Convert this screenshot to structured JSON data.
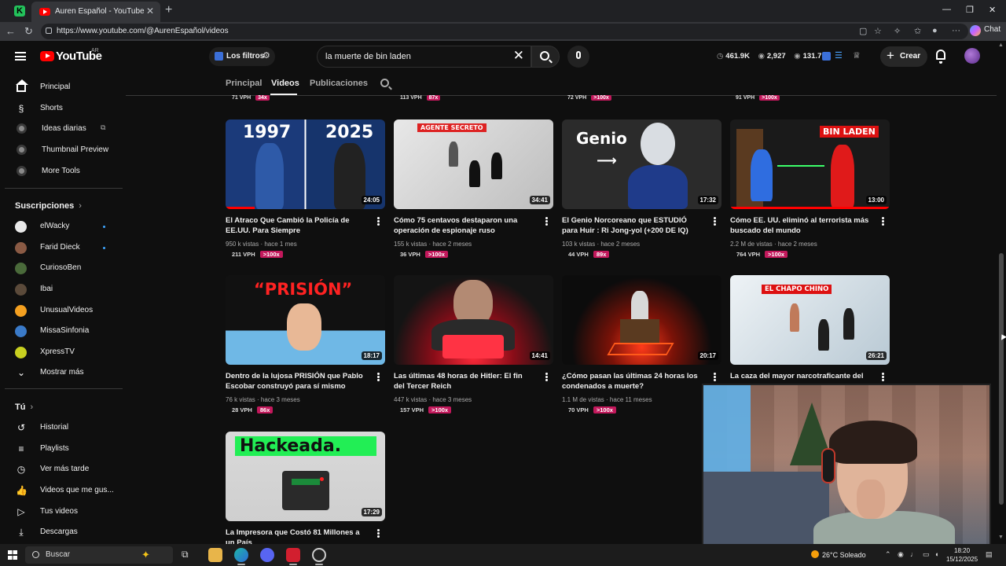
{
  "browser": {
    "tab_title": "Auren Español - YouTube",
    "url": "https://www.youtube.com/@AurenEspañol/videos",
    "chat_label": "Chat"
  },
  "header": {
    "logo": "YouTube",
    "country": "AR",
    "filters_label": "Los filtros",
    "search_value": "la muerte de bin laden",
    "stats": [
      "461.9K",
      "2,927",
      "131.7K"
    ],
    "create_label": "Crear"
  },
  "sidebar": {
    "main": [
      {
        "label": "Principal",
        "icon": "home-icon"
      },
      {
        "label": "Shorts",
        "icon": "shorts-icon"
      },
      {
        "label": "Ideas diarias",
        "icon": "bot-icon"
      },
      {
        "label": "Thumbnail Preview",
        "icon": "bot-icon"
      },
      {
        "label": "More Tools",
        "icon": "bot-icon"
      }
    ],
    "subs_heading": "Suscripciones",
    "subs": [
      {
        "label": "elWacky",
        "color": "#e9e9e9",
        "dot": true
      },
      {
        "label": "Farid Dieck",
        "color": "#8a5a44",
        "dot": true
      },
      {
        "label": "CuriosoBen",
        "color": "#4a6a3a",
        "dot": false
      },
      {
        "label": "Ibai",
        "color": "#5b4a3a",
        "dot": false
      },
      {
        "label": "UnusualVideos",
        "color": "#f4a020",
        "dot": false
      },
      {
        "label": "MissaSinfonia",
        "color": "#3a7ac8",
        "dot": false
      },
      {
        "label": "XpressTV",
        "color": "#c8d020",
        "dot": false
      }
    ],
    "show_more": "Mostrar más",
    "you_heading": "Tú",
    "you": [
      {
        "label": "Historial",
        "icon": "history-icon"
      },
      {
        "label": "Playlists",
        "icon": "playlists-icon"
      },
      {
        "label": "Ver más tarde",
        "icon": "clock-icon"
      },
      {
        "label": "Videos que me gus...",
        "icon": "like-icon"
      },
      {
        "label": "Tus videos",
        "icon": "play-icon"
      },
      {
        "label": "Descargas",
        "icon": "download-icon"
      }
    ]
  },
  "tabs": [
    "Principal",
    "Videos",
    "Publicaciones"
  ],
  "top_row": [
    {
      "vph": "71 VPH",
      "badge": "34x"
    },
    {
      "vph": "113 VPH",
      "badge": "87x"
    },
    {
      "vph": "72 VPH",
      "badge": ">100x"
    },
    {
      "vph": "91 VPH",
      "badge": ">100x"
    }
  ],
  "videos": [
    {
      "title": "El Atraco Que Cambió la Policía de EE.UU. Para Siempre",
      "views": "950 k vistas",
      "ago": "hace 1 mes",
      "vph": "211 VPH",
      "badge": ">100x",
      "duration": "24:05",
      "watched": 0.18,
      "thumb_texts": [
        "1997",
        "2025"
      ]
    },
    {
      "title": "Cómo 75 centavos destaparon una operación de espionaje ruso",
      "views": "155 k vistas",
      "ago": "hace 2 meses",
      "vph": "36 VPH",
      "badge": ">100x",
      "duration": "34:41",
      "watched": 0.0,
      "thumb_texts": [
        "AGENTE SECRETO"
      ]
    },
    {
      "title": "El Genio Norcoreano que ESTUDIÓ para Huir : Ri Jong-yol (+200 DE IQ)",
      "views": "103 k vistas",
      "ago": "hace 2 meses",
      "vph": "44 VPH",
      "badge": "89x",
      "duration": "17:32",
      "watched": 0.0,
      "thumb_texts": [
        "Genio"
      ]
    },
    {
      "title": "Cómo EE. UU. eliminó al terrorista más buscado del mundo",
      "views": "2.2 M de vistas",
      "ago": "hace 2 meses",
      "vph": "764 VPH",
      "badge": ">100x",
      "duration": "13:00",
      "watched": 1.0,
      "thumb_texts": [
        "BIN LADEN"
      ]
    },
    {
      "title": "Dentro de la lujosa PRISIÓN que Pablo Escobar construyó para sí mismo",
      "views": "76 k vistas",
      "ago": "hace 3 meses",
      "vph": "28 VPH",
      "badge": "86x",
      "duration": "18:17",
      "watched": 0.0,
      "thumb_texts": [
        "“PRISIÓN”"
      ]
    },
    {
      "title": "Las últimas 48 horas de Hitler: El fin del Tercer Reich",
      "views": "447 k vistas",
      "ago": "hace 3 meses",
      "vph": "157 VPH",
      "badge": ">100x",
      "duration": "14:41",
      "watched": 0.0,
      "thumb_texts": []
    },
    {
      "title": "¿Cómo pasan las últimas 24 horas los condenados a muerte?",
      "views": "1.1 M de vistas",
      "ago": "hace 11 meses",
      "vph": "70 VPH",
      "badge": ">100x",
      "duration": "20:17",
      "watched": 0.0,
      "thumb_texts": []
    },
    {
      "title": "La caza del mayor narcotraficante del",
      "views": "",
      "ago": "",
      "vph": "",
      "badge": "",
      "duration": "26:21",
      "watched": 0.0,
      "thumb_texts": [
        "EL CHAPO CHINO"
      ]
    },
    {
      "title": "La Impresora que Costó 81 Millones a un País",
      "views": "",
      "ago": "",
      "vph": "",
      "badge": "",
      "duration": "17:29",
      "watched": 0.0,
      "thumb_texts": [
        "Hackeada."
      ]
    }
  ],
  "taskbar": {
    "search_label": "Buscar",
    "weather": "26°C Soleado",
    "time": "18:20",
    "date": "15/12/2025"
  }
}
